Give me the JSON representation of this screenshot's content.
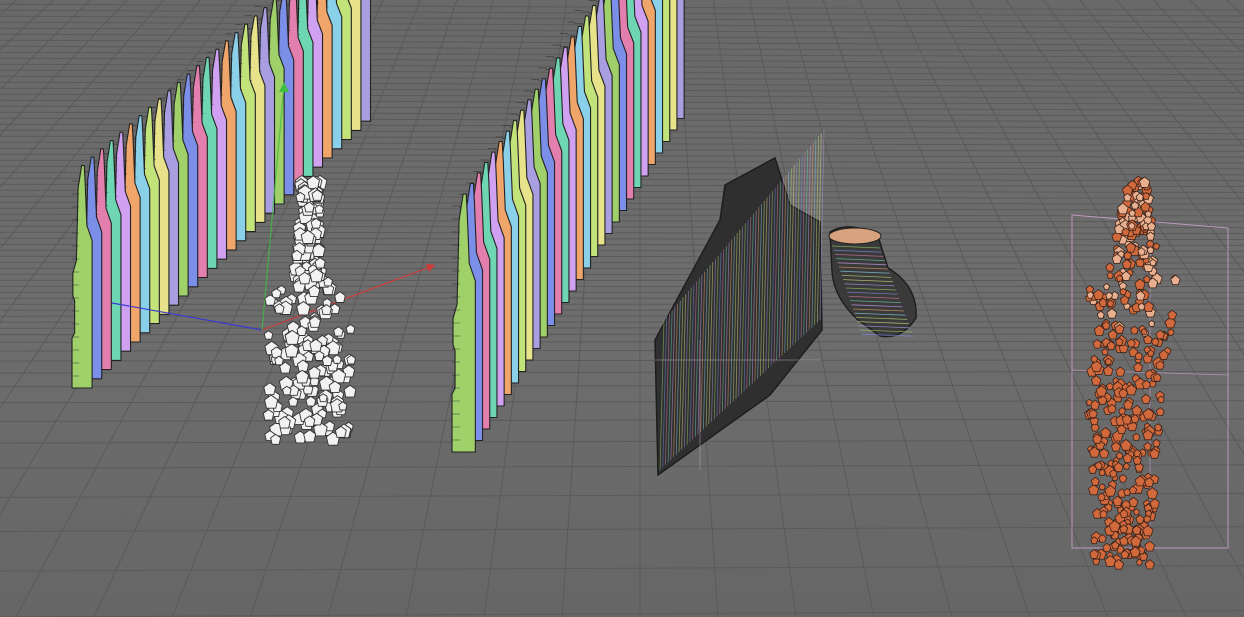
{
  "viewport": {
    "name": "",
    "background_color": "#6c6c6c",
    "grid_color": "#5a5a5a"
  },
  "objects": [
    {
      "id": "sliced-bottle-colored",
      "label": "",
      "selected": true
    },
    {
      "id": "sliced-bottle-colored-copy",
      "label": "",
      "selected": false
    },
    {
      "id": "dark-sliced-shell",
      "label": "",
      "selected": false
    },
    {
      "id": "sliced-bottle-neck",
      "label": "",
      "selected": false
    },
    {
      "id": "bottle-cloner-white",
      "label": "",
      "selected": false
    },
    {
      "id": "orange-particle-cloud",
      "label": "",
      "selected": false
    }
  ],
  "axis_colors": {
    "x": "#d23a3a",
    "y": "#3fbf3f",
    "z": "#3a3ad2"
  },
  "slice_palette": [
    "#9fd06a",
    "#7b8fe8",
    "#e27fae",
    "#6fd6b3",
    "#cfa1f0",
    "#f0a66b",
    "#8ad0e8",
    "#c2e27a",
    "#e8e28a",
    "#a89ee0"
  ],
  "particle_color": "#d2693c",
  "cloner_color": "#f2f2f2"
}
